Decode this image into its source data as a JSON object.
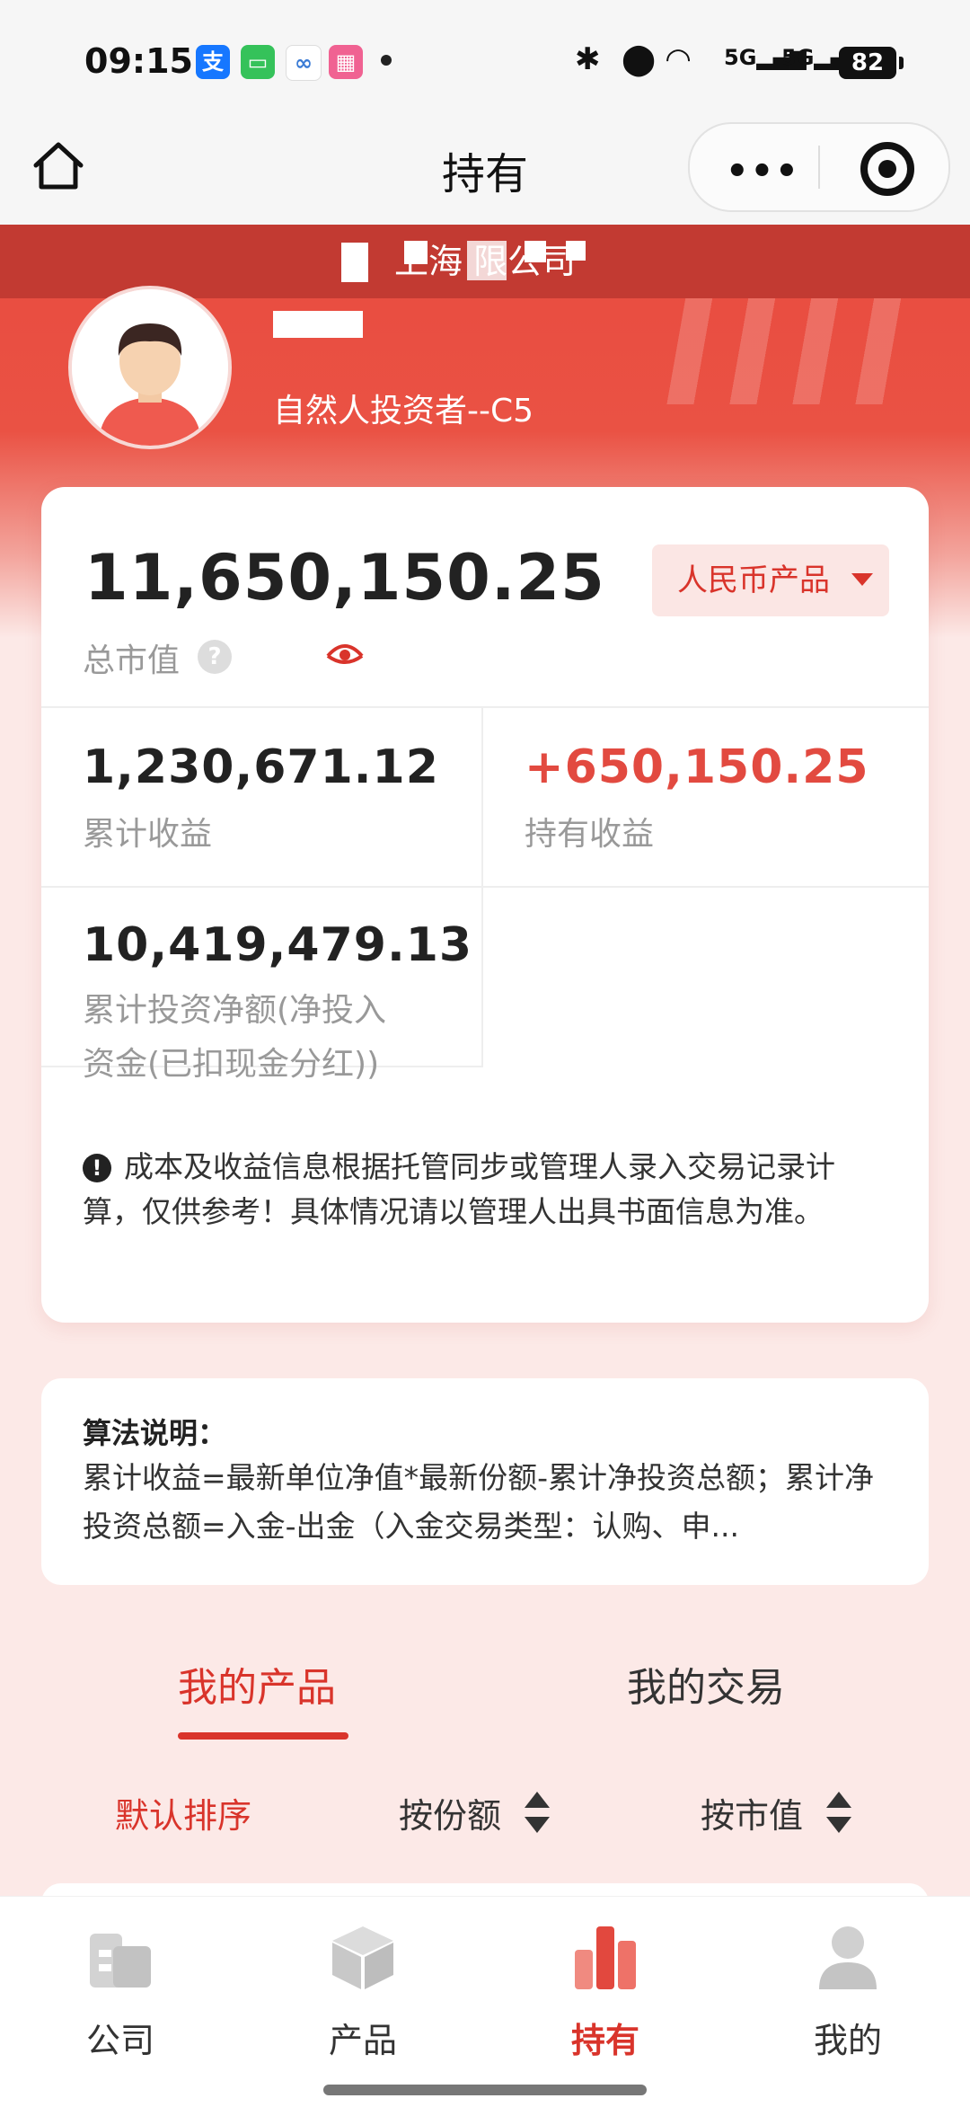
{
  "status_bar": {
    "time": "09:15",
    "battery": "82",
    "network": "5G"
  },
  "nav": {
    "title": "持有",
    "more_label": "•••"
  },
  "profile": {
    "company": "上海   限公司",
    "investor_type": "自然人投资者--C5"
  },
  "summary": {
    "total_value": "11,650,150.25",
    "total_label": "总市值",
    "currency_button": "人民币产品",
    "cumulative_income": "1,230,671.12",
    "cumulative_income_label": "累计收益",
    "holding_income": "+650,150.25",
    "holding_income_label": "持有收益",
    "net_investment": "10,419,479.13",
    "net_investment_label_line1": "累计投资净额(净投入",
    "net_investment_label_line2": "资金(已扣现金分红))",
    "notice": "成本及收益信息根据托管同步或管理人录入交易记录计算，仅供参考！具体情况请以管理人出具书面信息为准。"
  },
  "algorithm": {
    "title": "算法说明：",
    "text": "累计收益=最新单位净值*最新份额-累计净投资总额；累计净投资总额=入金-出金（入金交易类型：认购、申..."
  },
  "tabs": [
    {
      "label": "我的产品",
      "active": true
    },
    {
      "label": "我的交易",
      "active": false
    }
  ],
  "sort": {
    "default": "默认排序",
    "by_shares": "按份额",
    "by_value": "按市值"
  },
  "bottom_nav": [
    {
      "label": "公司",
      "icon": "building-icon"
    },
    {
      "label": "产品",
      "icon": "box-icon"
    },
    {
      "label": "持有",
      "icon": "bar-chart-icon",
      "active": true
    },
    {
      "label": "我的",
      "icon": "user-icon"
    }
  ],
  "colors": {
    "accent": "#d9342b",
    "positive": "#e24a40",
    "header": "#e84b3f"
  }
}
